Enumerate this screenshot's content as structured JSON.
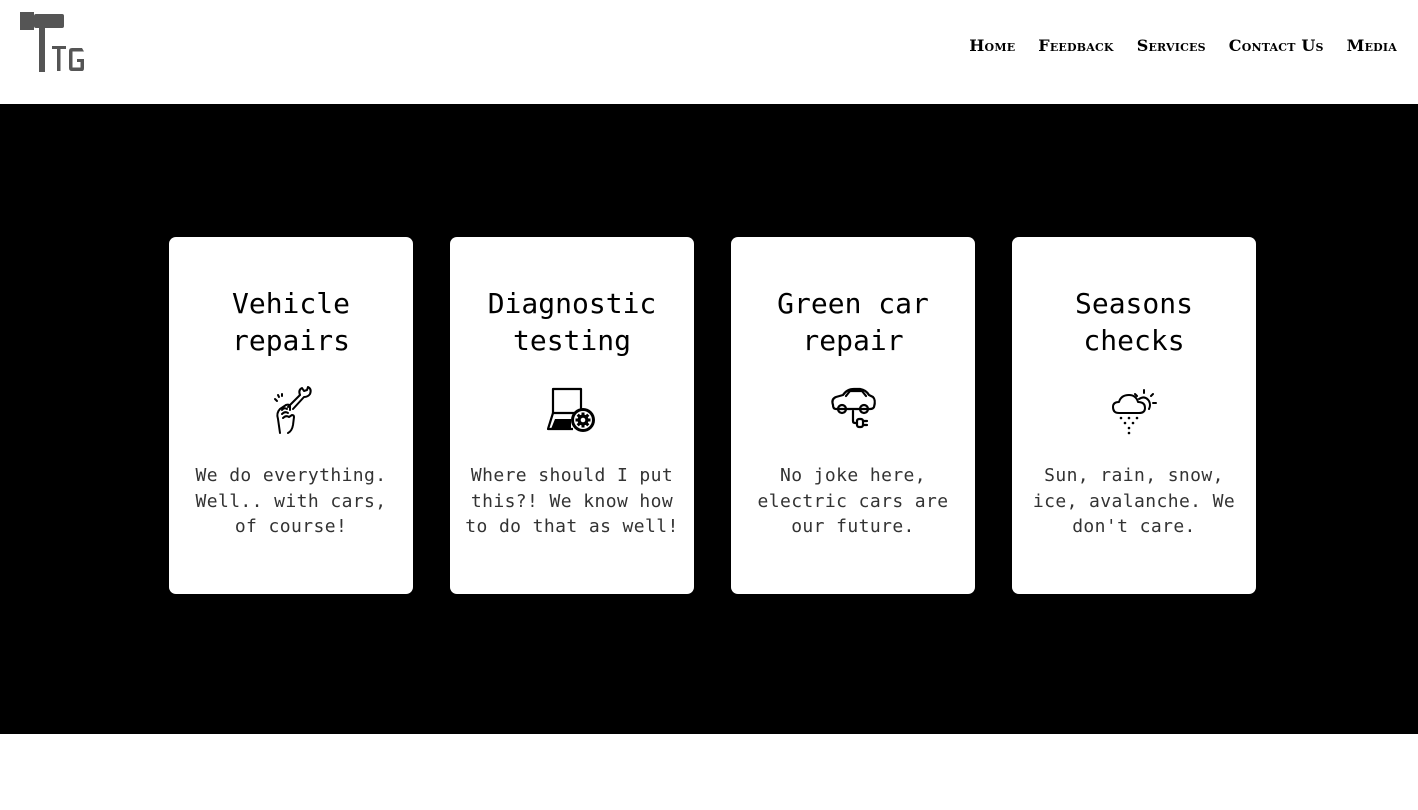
{
  "header": {
    "logo_text": "TG",
    "nav": [
      {
        "label": "Home"
      },
      {
        "label": "Feedback"
      },
      {
        "label": "Services"
      },
      {
        "label": "Contact Us"
      },
      {
        "label": "Media"
      }
    ]
  },
  "services": [
    {
      "title": "Vehicle repairs",
      "icon": "wrench-hand-icon",
      "text": "We do everything. Well.. with cars, of course!"
    },
    {
      "title": "Diagnostic testing",
      "icon": "laptop-gear-icon",
      "text": "Where should I put this?! We know how to do that as well!"
    },
    {
      "title": "Green car repair",
      "icon": "electric-car-icon",
      "text": "No joke here, electric cars are our future."
    },
    {
      "title": "Seasons checks",
      "icon": "weather-icon",
      "text": "Sun, rain, snow, ice, avalanche. We don't care."
    }
  ],
  "colors": {
    "hero_background": "#000000",
    "card_background": "#ffffff",
    "logo": "#555555"
  }
}
